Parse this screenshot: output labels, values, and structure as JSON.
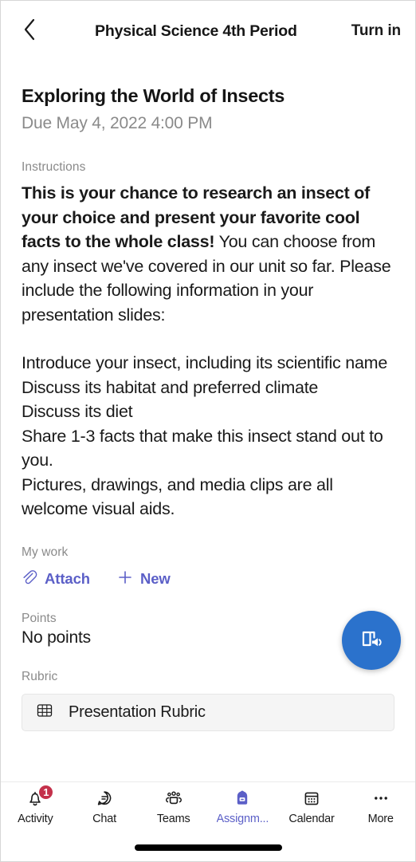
{
  "header": {
    "back_icon": "chevron-left-icon",
    "title": "Physical Science 4th Period",
    "turn_in_label": "Turn in"
  },
  "assignment": {
    "title": "Exploring the World of Insects",
    "due": "Due May 4, 2022 4:00 PM",
    "instructions_label": "Instructions",
    "instructions_bold": "This is your chance to research an insect of your choice and present your favorite cool facts to the whole class!",
    "instructions_rest": " You can choose from any insect we've covered in our unit so far. Please include the following information in your presentation slides:",
    "requirements": "Introduce your insect, including its scientific name\nDiscuss its habitat and preferred climate\nDiscuss its diet\nShare 1-3 facts that make this insect stand out to you.\nPictures, drawings, and media clips are all welcome visual aids."
  },
  "my_work": {
    "label": "My work",
    "attach_label": "Attach",
    "attach_icon": "paperclip-icon",
    "new_label": "New",
    "new_icon": "plus-icon"
  },
  "points": {
    "label": "Points",
    "value": "No points"
  },
  "rubric": {
    "label": "Rubric",
    "card_icon": "grid-table-icon",
    "card_name": "Presentation Rubric"
  },
  "fab": {
    "icon": "immersive-reader-icon"
  },
  "bottom_nav": {
    "items": [
      {
        "label": "Activity",
        "icon": "bell-icon",
        "badge": "1"
      },
      {
        "label": "Chat",
        "icon": "chat-bubble-icon"
      },
      {
        "label": "Teams",
        "icon": "people-icon"
      },
      {
        "label": "Assignm...",
        "icon": "backpack-icon"
      },
      {
        "label": "Calendar",
        "icon": "calendar-icon"
      },
      {
        "label": "More",
        "icon": "ellipsis-icon"
      }
    ]
  },
  "colors": {
    "accent_purple": "#5b5fc7",
    "fab_blue": "#2b72cc",
    "badge_red": "#c4314b",
    "muted_gray": "#8a8a8a"
  }
}
